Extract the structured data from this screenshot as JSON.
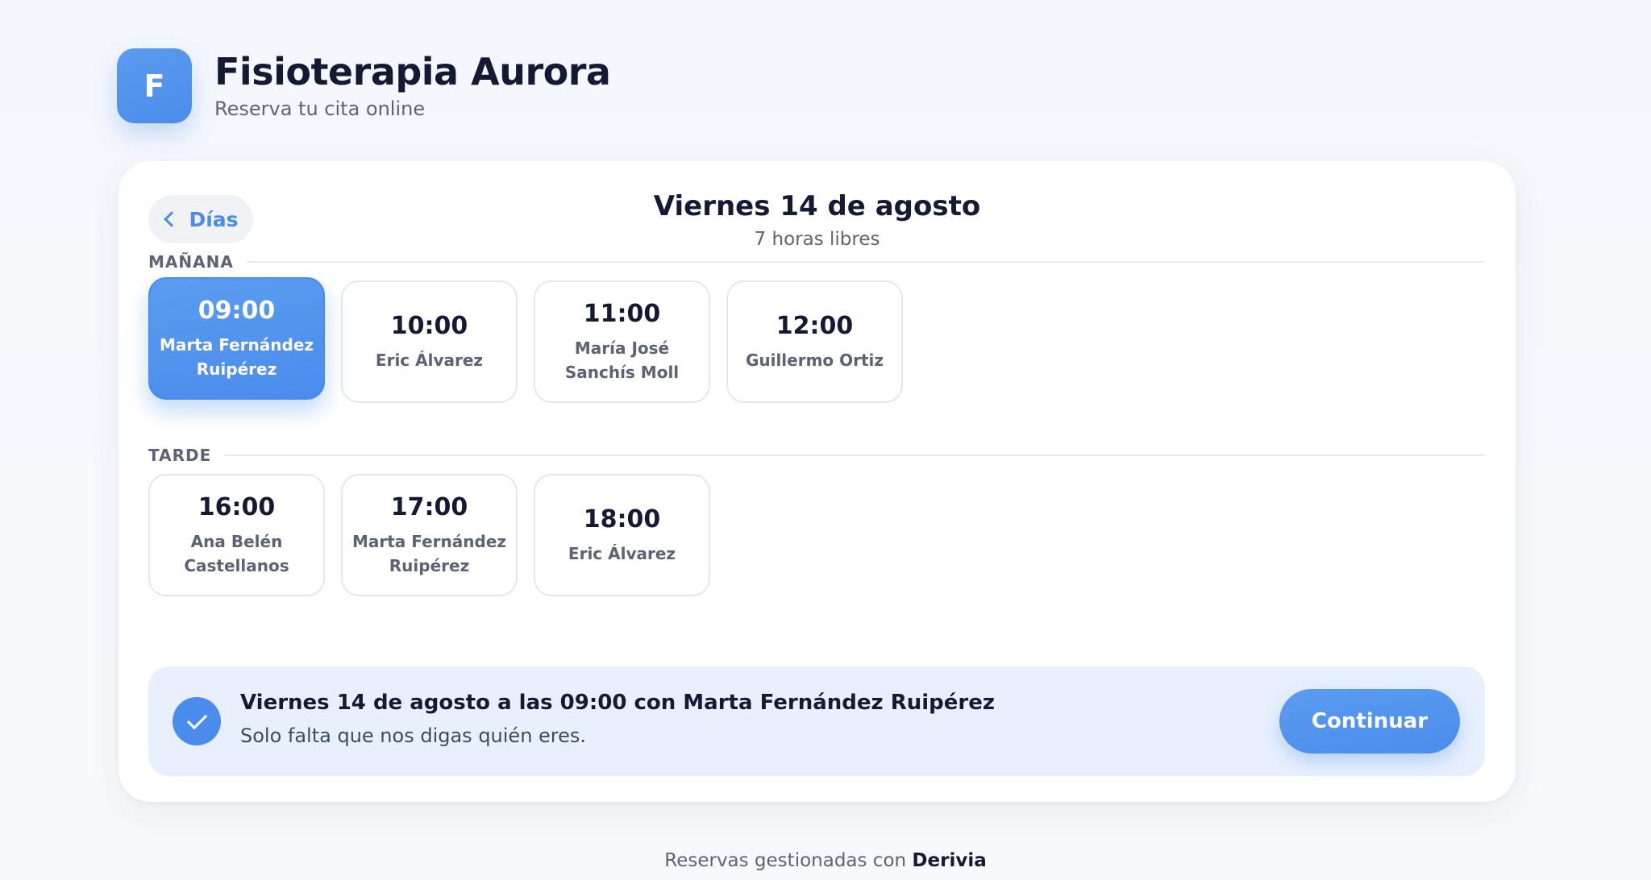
{
  "header": {
    "logo_letter": "F",
    "title": "Fisioterapia Aurora",
    "subtitle": "Reserva tu cita online"
  },
  "nav": {
    "back_label": "Días"
  },
  "day": {
    "title": "Viernes 14 de agosto",
    "availability": "7 horas libres"
  },
  "sections": {
    "morning": {
      "label": "MAÑANA",
      "slots": [
        {
          "time": "09:00",
          "therapist": "Marta Fernández Ruipérez",
          "selected": true
        },
        {
          "time": "10:00",
          "therapist": "Eric Álvarez",
          "selected": false
        },
        {
          "time": "11:00",
          "therapist": "María José Sanchís Moll",
          "selected": false
        },
        {
          "time": "12:00",
          "therapist": "Guillermo Ortiz",
          "selected": false
        }
      ]
    },
    "afternoon": {
      "label": "TARDE",
      "slots": [
        {
          "time": "16:00",
          "therapist": "Ana Belén Castellanos",
          "selected": false
        },
        {
          "time": "17:00",
          "therapist": "Marta Fernández Ruipérez",
          "selected": false
        },
        {
          "time": "18:00",
          "therapist": "Eric Álvarez",
          "selected": false
        }
      ]
    }
  },
  "summary": {
    "title": "Viernes 14 de agosto a las 09:00 con Marta Fernández Ruipérez",
    "subtitle": "Solo falta que nos digas quién eres.",
    "continue_label": "Continuar"
  },
  "footer": {
    "prefix": "Reservas gestionadas con",
    "brand": "Derivia"
  },
  "colors": {
    "accent": "#4a8ceb",
    "summary_bg": "#e8f0fd"
  },
  "icons": {
    "back": "chevron-left-icon",
    "confirm": "check-icon"
  }
}
